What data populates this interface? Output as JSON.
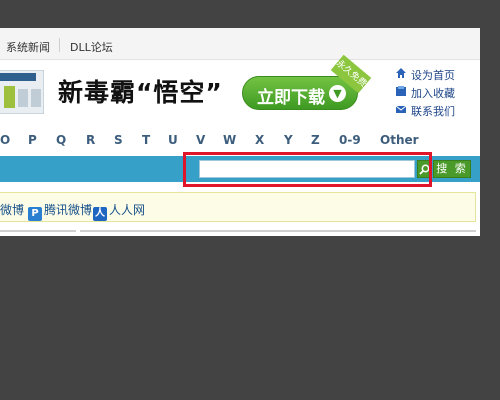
{
  "topnav": {
    "item1": "系统新闻",
    "item2": "DLL论坛"
  },
  "banner": {
    "title": "新毒霸“悟空”",
    "download_label": "立即下载",
    "download_icon": "download-arrow-icon",
    "ribbon": "永久免费",
    "accent_color": "#4caf32"
  },
  "quick_links": [
    {
      "label": "设为首页",
      "icon": "home-icon"
    },
    {
      "label": "加入收藏",
      "icon": "bookmark-icon"
    },
    {
      "label": "联系我们",
      "icon": "contact-icon"
    }
  ],
  "letters": [
    "O",
    "P",
    "Q",
    "R",
    "S",
    "T",
    "U",
    "V",
    "W",
    "X",
    "Y",
    "Z",
    "0-9",
    "Other"
  ],
  "search": {
    "value": "",
    "placeholder": "",
    "icon": "search-icon",
    "button_label": "搜 索",
    "highlight_color": "#e0152a"
  },
  "share": {
    "weibo_label": "微博",
    "tencent_label": "腾讯微博",
    "renren_label": "人人网"
  },
  "colors": {
    "background": "#434343",
    "blue_bar": "#36a0c9",
    "share_bar": "#fdfde7"
  }
}
